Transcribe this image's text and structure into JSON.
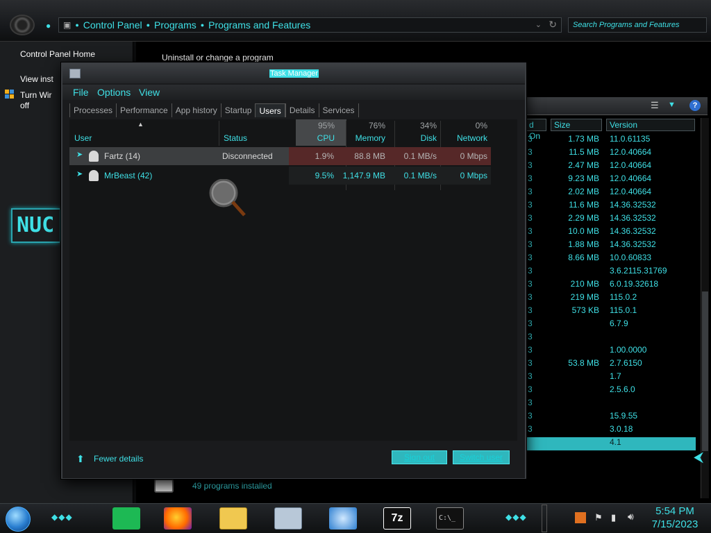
{
  "colors": {
    "accent": "#3fe0e6",
    "selection": "#2fb7bd",
    "heat": "#5a2424"
  },
  "explorer": {
    "breadcrumbs": [
      "Control Panel",
      "Programs",
      "Programs and Features"
    ],
    "search_placeholder": "Search Programs and Features",
    "left_links": [
      "Control Panel Home",
      "View inst",
      "Turn Wir",
      "off"
    ],
    "page_title": "Uninstall or change a program",
    "status": "49 programs installed",
    "logo_text": "NUC"
  },
  "program_list": {
    "headers": [
      "d On",
      "Size",
      "Version"
    ],
    "rows": [
      {
        "c1": "3",
        "size": "1.73 MB",
        "version": "11.0.61135"
      },
      {
        "c1": "3",
        "size": "11.5 MB",
        "version": "12.0.40664"
      },
      {
        "c1": "3",
        "size": "2.47 MB",
        "version": "12.0.40664"
      },
      {
        "c1": "3",
        "size": "9.23 MB",
        "version": "12.0.40664"
      },
      {
        "c1": "3",
        "size": "2.02 MB",
        "version": "12.0.40664"
      },
      {
        "c1": "3",
        "size": "11.6 MB",
        "version": "14.36.32532"
      },
      {
        "c1": "3",
        "size": "2.29 MB",
        "version": "14.36.32532"
      },
      {
        "c1": "3",
        "size": "10.0 MB",
        "version": "14.36.32532"
      },
      {
        "c1": "3",
        "size": "1.88 MB",
        "version": "14.36.32532"
      },
      {
        "c1": "3",
        "size": "8.66 MB",
        "version": "10.0.60833"
      },
      {
        "c1": "3",
        "size": "",
        "version": "3.6.2115.31769"
      },
      {
        "c1": "3",
        "size": "210 MB",
        "version": "6.0.19.32618"
      },
      {
        "c1": "3",
        "size": "219 MB",
        "version": "115.0.2"
      },
      {
        "c1": "3",
        "size": "573 KB",
        "version": "115.0.1"
      },
      {
        "c1": "3",
        "size": "",
        "version": "6.7.9"
      },
      {
        "c1": "3",
        "size": "",
        "version": ""
      },
      {
        "c1": "3",
        "size": "",
        "version": "1.00.0000"
      },
      {
        "c1": "3",
        "size": "53.8 MB",
        "version": "2.7.6150"
      },
      {
        "c1": "3",
        "size": "",
        "version": "1.7"
      },
      {
        "c1": "3",
        "size": "",
        "version": "2.5.6.0"
      },
      {
        "c1": "3",
        "size": "",
        "version": ""
      },
      {
        "c1": "3",
        "size": "",
        "version": "15.9.55"
      },
      {
        "c1": "3",
        "size": "",
        "version": "3.0.18"
      },
      {
        "c1": "",
        "size": "",
        "version": "4.1"
      }
    ]
  },
  "task_manager": {
    "title": "Task Manager",
    "menu": [
      "File",
      "Options",
      "View"
    ],
    "tabs": [
      "Processes",
      "Performance",
      "App history",
      "Startup",
      "Users",
      "Details",
      "Services"
    ],
    "active_tab": "Users",
    "columns": {
      "user": "User",
      "status": "Status",
      "cpu": {
        "pct": "95%",
        "label": "CPU"
      },
      "memory": {
        "pct": "76%",
        "label": "Memory"
      },
      "disk": {
        "pct": "34%",
        "label": "Disk"
      },
      "network": {
        "pct": "0%",
        "label": "Network"
      }
    },
    "users": [
      {
        "name": "Fartz (14)",
        "status": "Disconnected",
        "cpu": "1.9%",
        "memory": "88.8 MB",
        "disk": "0.1 MB/s",
        "network": "0 Mbps"
      },
      {
        "name": "MrBeast (42)",
        "status": "",
        "cpu": "9.5%",
        "memory": "1,147.9 MB",
        "disk": "0.1 MB/s",
        "network": "0 Mbps"
      }
    ],
    "fewer_details": "Fewer details",
    "sign_out": "Sign out",
    "switch_user": "Switch user"
  },
  "taskbar": {
    "apps": [
      "spotify",
      "firefox",
      "file-explorer",
      "task-manager",
      "media",
      "7-zip",
      "terminal"
    ],
    "seven_zip_label": "7z",
    "terminal_label": "C:\\_",
    "time": "5:54 PM",
    "date": "7/15/2023"
  }
}
